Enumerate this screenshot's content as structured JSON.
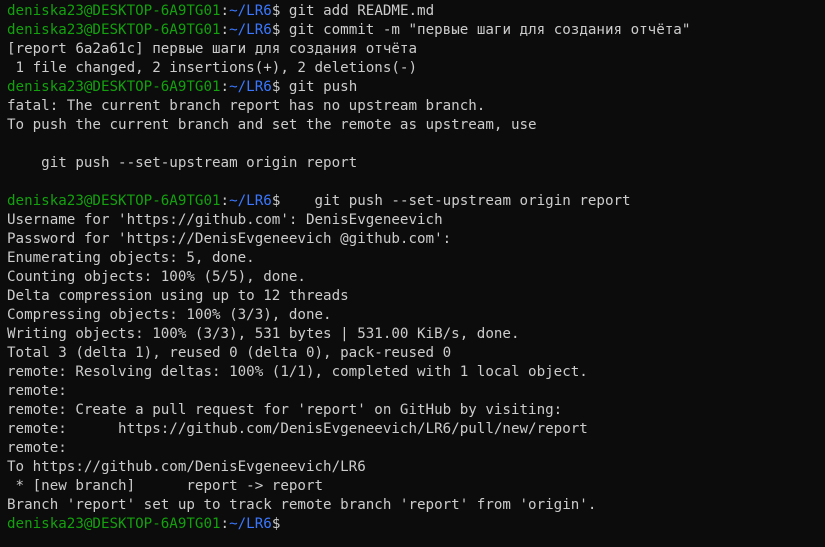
{
  "prompt": {
    "user_host": "deniska23@DESKTOP-6A9TG01",
    "colon": ":",
    "path": "~/LR6",
    "dollar": "$"
  },
  "colors": {
    "background": "#0c0c0c",
    "text": "#cccccc",
    "user_host": "#13a10e",
    "path": "#3b78ff"
  },
  "lines": [
    {
      "type": "prompt",
      "cmd": " git add README.md"
    },
    {
      "type": "prompt",
      "cmd": " git commit -m \"первые шаги для создания отчёта\""
    },
    {
      "type": "output",
      "text": "[report 6a2a61c] первые шаги для создания отчёта"
    },
    {
      "type": "output",
      "text": " 1 file changed, 2 insertions(+), 2 deletions(-)"
    },
    {
      "type": "prompt",
      "cmd": " git push"
    },
    {
      "type": "output",
      "text": "fatal: The current branch report has no upstream branch."
    },
    {
      "type": "output",
      "text": "To push the current branch and set the remote as upstream, use"
    },
    {
      "type": "output",
      "text": ""
    },
    {
      "type": "output",
      "text": "    git push --set-upstream origin report"
    },
    {
      "type": "output",
      "text": ""
    },
    {
      "type": "prompt",
      "cmd": "    git push --set-upstream origin report"
    },
    {
      "type": "output",
      "text": "Username for 'https://github.com': DenisEvgeneevich"
    },
    {
      "type": "output",
      "text": "Password for 'https://DenisEvgeneevich @github.com':"
    },
    {
      "type": "output",
      "text": "Enumerating objects: 5, done."
    },
    {
      "type": "output",
      "text": "Counting objects: 100% (5/5), done."
    },
    {
      "type": "output",
      "text": "Delta compression using up to 12 threads"
    },
    {
      "type": "output",
      "text": "Compressing objects: 100% (3/3), done."
    },
    {
      "type": "output",
      "text": "Writing objects: 100% (3/3), 531 bytes | 531.00 KiB/s, done."
    },
    {
      "type": "output",
      "text": "Total 3 (delta 1), reused 0 (delta 0), pack-reused 0"
    },
    {
      "type": "output",
      "text": "remote: Resolving deltas: 100% (1/1), completed with 1 local object."
    },
    {
      "type": "output",
      "text": "remote:"
    },
    {
      "type": "output",
      "text": "remote: Create a pull request for 'report' on GitHub by visiting:"
    },
    {
      "type": "output",
      "text": "remote:      https://github.com/DenisEvgeneevich/LR6/pull/new/report"
    },
    {
      "type": "output",
      "text": "remote:"
    },
    {
      "type": "output",
      "text": "To https://github.com/DenisEvgeneevich/LR6"
    },
    {
      "type": "output",
      "text": " * [new branch]      report -> report"
    },
    {
      "type": "output",
      "text": "Branch 'report' set up to track remote branch 'report' from 'origin'."
    },
    {
      "type": "prompt",
      "cmd": ""
    }
  ]
}
